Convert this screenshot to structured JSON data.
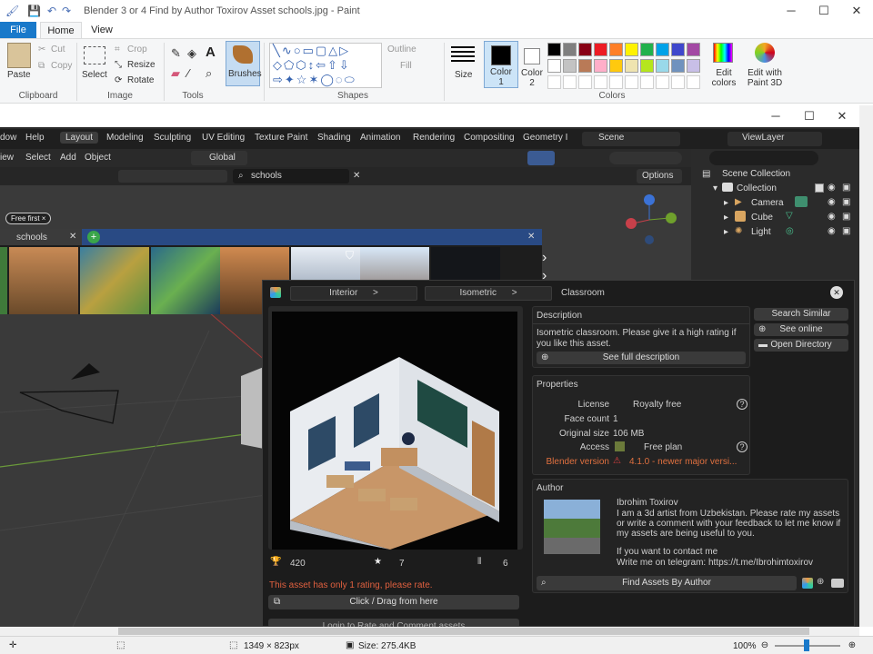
{
  "paint": {
    "title": "Blender 3 or 4 Find by Author Toxirov Asset schools.jpg - Paint",
    "tabs": [
      "File",
      "Home",
      "View"
    ],
    "clipboard": {
      "paste": "Paste",
      "cut": "Cut",
      "copy": "Copy",
      "label": "Clipboard"
    },
    "image": {
      "select": "Select",
      "crop": "Crop",
      "resize": "Resize",
      "rotate": "Rotate",
      "label": "Image"
    },
    "tools": {
      "label": "Tools",
      "brushes": "Brushes"
    },
    "shapes": {
      "outline": "Outline",
      "fill": "Fill",
      "label": "Shapes"
    },
    "size": "Size",
    "color1": "Color\n1",
    "color2": "Color\n2",
    "edit_colors": "Edit\ncolors",
    "edit_3d": "Edit with\nPaint 3D",
    "colors_label": "Colors",
    "palette_row1": [
      "#000000",
      "#7f7f7f",
      "#880015",
      "#ed1c24",
      "#ff7f27",
      "#fff200",
      "#22b14c",
      "#00a2e8",
      "#3f48cc",
      "#a349a4"
    ],
    "palette_row2": [
      "#ffffff",
      "#c3c3c3",
      "#b97a57",
      "#ffaec9",
      "#ffc90e",
      "#efe4b0",
      "#b5e61d",
      "#99d9ea",
      "#7092be",
      "#c8bfe7"
    ],
    "status": {
      "dimensions": "1349 × 823px",
      "size": "Size: 275.4KB",
      "zoom": "100%"
    }
  },
  "blender": {
    "menus": [
      "dow",
      "Help"
    ],
    "workspaces": [
      "Layout",
      "Modeling",
      "Sculpting",
      "UV Editing",
      "Texture Paint",
      "Shading",
      "Animation",
      "Rendering",
      "Compositing",
      "Geometry I"
    ],
    "scene": "Scene",
    "view_layer": "ViewLayer",
    "view_menus": [
      "iew",
      "Select",
      "Add",
      "Object"
    ],
    "transform": "Global",
    "search_value": "schools",
    "options": "Options",
    "free_first": "Free first ×",
    "browser_tab": "schools",
    "outliner": {
      "collection_root": "Scene Collection",
      "collection": "Collection",
      "items": [
        "Camera",
        "Cube",
        "Light"
      ]
    }
  },
  "asset": {
    "breadcrumbs": [
      "Interior",
      ">",
      "Isometric",
      ">",
      "Classroom"
    ],
    "description_title": "Description",
    "description": "Isometric classroom. Please give it a high rating if you like this asset.",
    "see_full": "See full description",
    "properties_title": "Properties",
    "properties": [
      {
        "key": "License",
        "value": "Royalty free"
      },
      {
        "key": "Face count",
        "value": "1"
      },
      {
        "key": "Original size",
        "value": "106 MB"
      },
      {
        "key": "Access",
        "value": "Free plan"
      },
      {
        "key": "Blender version",
        "value": "4.1.0 - newer major versi..."
      }
    ],
    "search_similar": "Search Similar",
    "see_online": "See online",
    "open_directory": "Open Directory",
    "author_title": "Author",
    "author_name": "Ibrohim Toxirov",
    "author_bio": "I am a 3d artist from Uzbekistan. Please rate my assets or write a comment with your feedback to let me know if my assets are being useful to you.",
    "contact1": "If you want to contact me",
    "contact2": "Write me on telegram: https://t.me/Ibrohimtoxirov",
    "find_assets": "Find Assets By Author",
    "downloads": "420",
    "rating": "7",
    "rating_count": "6",
    "rating_note": "This asset has only 1 rating, please rate.",
    "click_drag": "Click / Drag from here",
    "login_rate": "Login to Rate and Comment assets"
  }
}
